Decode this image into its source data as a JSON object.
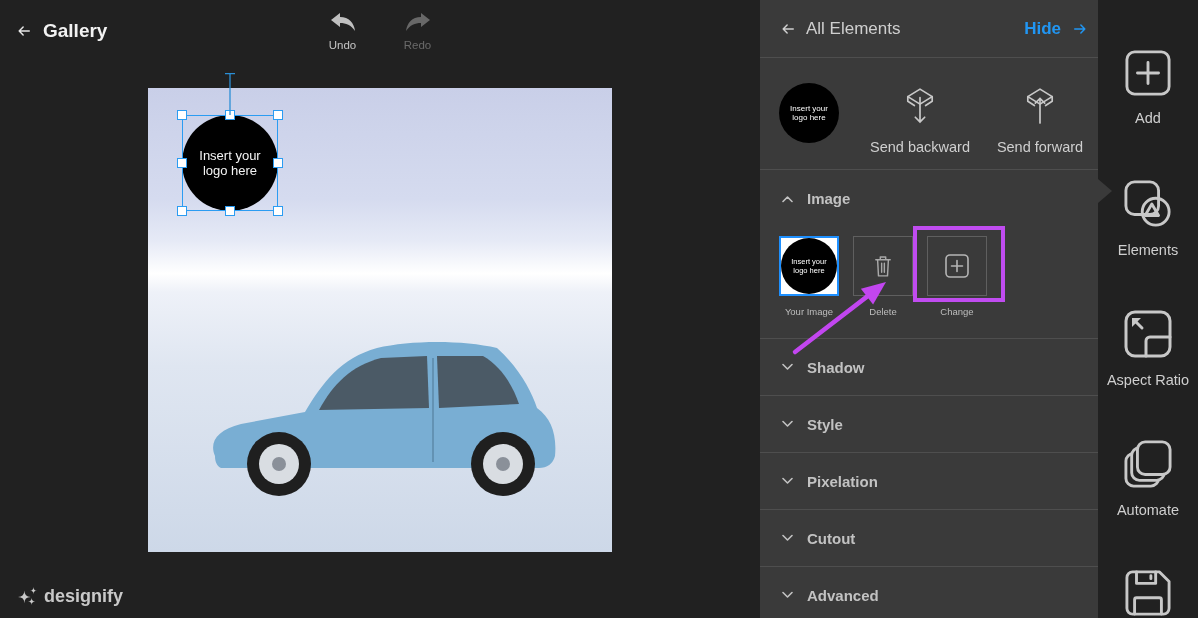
{
  "header": {
    "title": "Gallery"
  },
  "history": [
    {
      "kind": "undo",
      "label": "Undo",
      "disabled": false
    },
    {
      "kind": "redo",
      "label": "Redo",
      "disabled": true
    }
  ],
  "canvas": {
    "logo_text": "Insert your logo here",
    "selected": true
  },
  "brand": {
    "name": "designify"
  },
  "panel": {
    "title": "All Elements",
    "hide": "Hide",
    "preview_text": "Insert your logo here",
    "layer_actions": [
      {
        "kind": "backward",
        "label": "Send backward"
      },
      {
        "kind": "forward",
        "label": "Send forward"
      }
    ]
  },
  "image_section": {
    "title": "Image",
    "expanded": true,
    "tiles": [
      {
        "kind": "thumbnail",
        "text": "Insert your logo here",
        "label": "Your Image",
        "selected": true,
        "highlighted": false,
        "arrow": false
      },
      {
        "kind": "delete",
        "label": "Delete",
        "selected": false,
        "highlighted": false,
        "arrow": true
      },
      {
        "kind": "change",
        "label": "Change",
        "selected": false,
        "highlighted": true,
        "arrow": false
      }
    ]
  },
  "sections": [
    {
      "title": "Shadow",
      "expanded": false
    },
    {
      "title": "Style",
      "expanded": false
    },
    {
      "title": "Pixelation",
      "expanded": false
    },
    {
      "title": "Cutout",
      "expanded": false
    },
    {
      "title": "Advanced",
      "expanded": false
    }
  ],
  "rail": [
    {
      "kind": "add",
      "label": "Add",
      "selected": false
    },
    {
      "kind": "elements",
      "label": "Elements",
      "selected": true
    },
    {
      "kind": "aspect",
      "label": "Aspect Ratio",
      "selected": false
    },
    {
      "kind": "automate",
      "label": "Automate",
      "selected": false
    },
    {
      "kind": "save",
      "selected": false
    }
  ]
}
